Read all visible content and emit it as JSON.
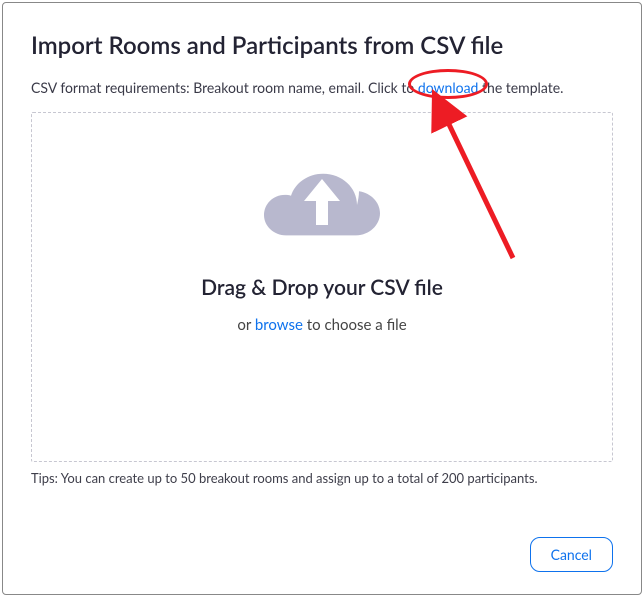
{
  "dialog": {
    "title": "Import Rooms and Participants from CSV file",
    "format_prefix": "CSV format requirements: Breakout room name, email. Click to ",
    "download_link": "download",
    "format_suffix": " the template.",
    "dropzone": {
      "title": "Drag & Drop your CSV file",
      "or_text": "or ",
      "browse_link": "browse",
      "choose_text": " to choose a file"
    },
    "tips": "Tips: You can create up to 50 breakout rooms and assign up to a total of 200 participants.",
    "cancel_label": "Cancel"
  },
  "annotation": {
    "color": "#ed1c24"
  }
}
